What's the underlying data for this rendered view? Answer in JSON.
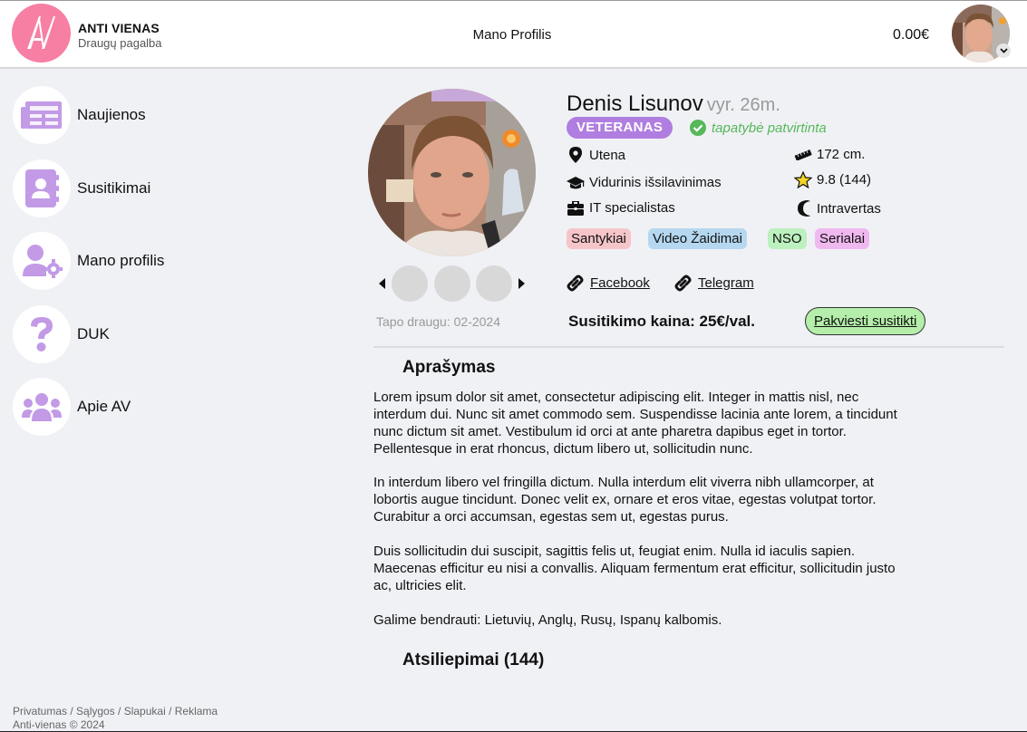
{
  "header": {
    "brand_title": "ANTI VIENAS",
    "brand_subtitle": "Draugų pagalba",
    "logo_text": "AV",
    "page_title": "Mano Profilis",
    "balance": "0.00€"
  },
  "sidebar": {
    "items": [
      {
        "label": "Naujienos",
        "icon": "newspaper-icon"
      },
      {
        "label": "Susitikimai",
        "icon": "address-book-icon"
      },
      {
        "label": "Mano profilis",
        "icon": "user-gear-icon"
      },
      {
        "label": "DUK",
        "icon": "question-icon"
      },
      {
        "label": "Apie AV",
        "icon": "users-icon"
      }
    ]
  },
  "profile": {
    "name": "Denis Lisunov",
    "age": "vyr. 26m.",
    "badge": "VETERANAS",
    "verified": "tapatybė patvirtinta",
    "joined": "Tapo draugu: 02-2024",
    "info_left": [
      {
        "icon": "location-pin-icon",
        "text": "Utena"
      },
      {
        "icon": "graduation-cap-icon",
        "text": "Vidurinis išsilavinimas"
      },
      {
        "icon": "briefcase-icon",
        "text": "IT specialistas"
      }
    ],
    "info_right": [
      {
        "icon": "ruler-icon",
        "text": "172 cm."
      },
      {
        "icon": "star-icon",
        "text": "9.8 (144)"
      },
      {
        "icon": "moon-icon",
        "text": "Intravertas"
      }
    ],
    "tags": [
      {
        "label": "Santykiai",
        "color": "#f6c5c9"
      },
      {
        "label": "Video Žaidimai",
        "color": "#b5d8f0"
      },
      {
        "label": "NSO",
        "color": "#bdf0bf"
      },
      {
        "label": "Serialai",
        "color": "#efb8ef"
      }
    ],
    "links": [
      {
        "label": "Facebook"
      },
      {
        "label": "Telegram"
      }
    ],
    "price": "Susitikimo kaina: 25€/val.",
    "invite_button": "Pakviesti susitikti"
  },
  "description": {
    "title": "Aprašymas",
    "paragraphs": [
      "Lorem ipsum dolor sit amet, consectetur adipiscing elit. Integer in  mattis nisl, nec\ninterdum dui. Nunc sit amet commodo sem. Suspendisse  lacinia ante lorem, a tincidunt\nnunc dictum sit amet. Vestibulum id orci  at ante pharetra dapibus eget in tortor.\nPellentesque in erat rhoncus,  dictum libero ut, sollicitudin nunc.",
      "In interdum libero vel fringilla  dictum. Nulla interdum elit viverra nibh ullamcorper, at\nlobortis augue  tincidunt. Donec velit ex, ornare et eros vitae, egestas volutpat  tortor.\nCurabitur a orci accumsan, egestas sem ut, egestas purus.",
      "Duis sollicitudin dui suscipit, sagittis felis ut, feugiat enim. Nulla  id iaculis sapien.\nMaecenas efficitur eu nisi a convallis. Aliquam  fermentum erat efficitur, sollicitudin justo\nac, ultricies elit.",
      "Galime bendrauti: Lietuvių, Anglų, Rusų, Ispanų kalbomis."
    ]
  },
  "reviews": {
    "title": "Atsiliepimai (144)"
  },
  "footer": {
    "links": "Privatumas / Sąlygos / Slapukai / Reklama",
    "copyright": "Anti-vienas © 2024"
  },
  "colors": {
    "accent_purple": "#b07de0",
    "nav_icon": "#c29ae6",
    "verified_green": "#55b85a",
    "invite_green": "#b4eeaa",
    "logo_pink": "#f77fa3"
  }
}
